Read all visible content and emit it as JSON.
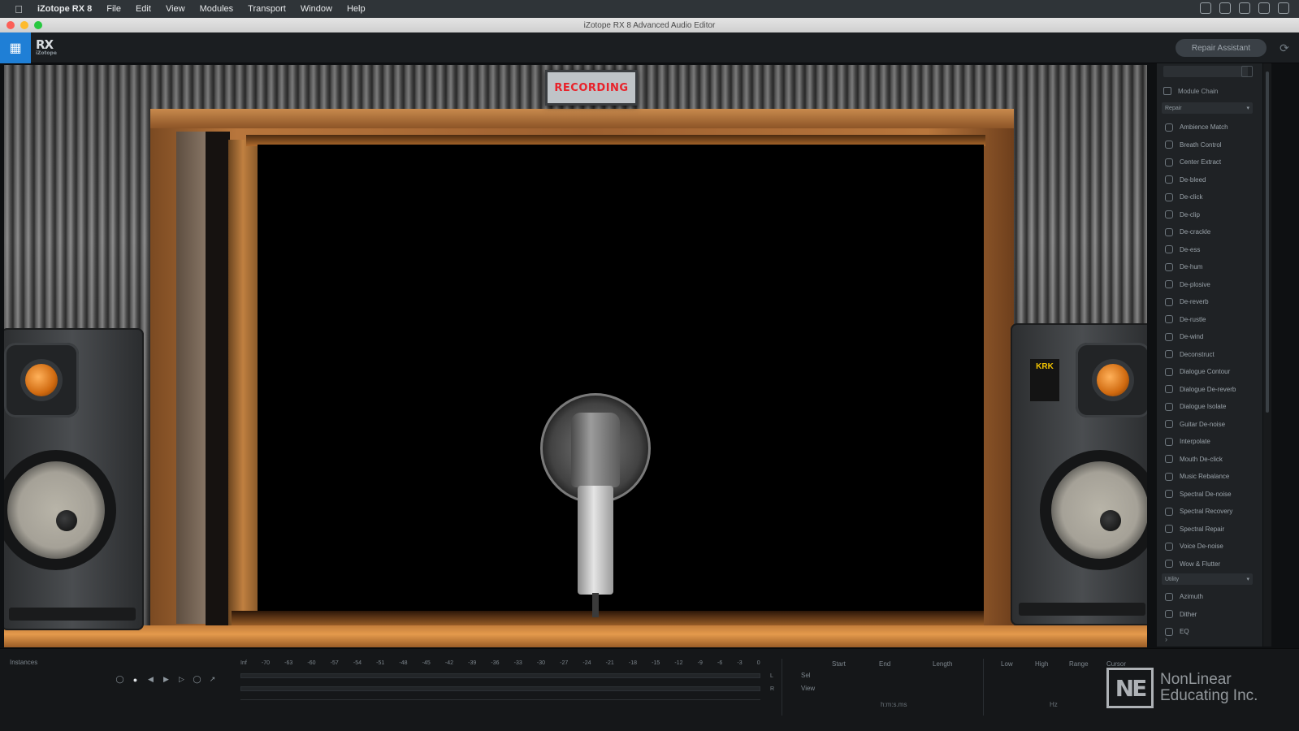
{
  "menubar": {
    "app_name": "iZotope RX 8",
    "items": [
      "File",
      "Edit",
      "View",
      "Modules",
      "Transport",
      "Window",
      "Help"
    ]
  },
  "window": {
    "title": "iZotope RX 8 Advanced Audio Editor"
  },
  "toolbar": {
    "logo": "RX",
    "logo_sub": "iZotope",
    "repair_assistant": "Repair Assistant"
  },
  "video": {
    "sign_text": "RECORDING",
    "speaker_brand": "KRK"
  },
  "sidebar": {
    "module_chain": "Module Chain",
    "repair_group": "Repair",
    "modules": [
      "Ambience Match",
      "Breath Control",
      "Center Extract",
      "De-bleed",
      "De-click",
      "De-clip",
      "De-crackle",
      "De-ess",
      "De-hum",
      "De-plosive",
      "De-reverb",
      "De-rustle",
      "De-wind",
      "Deconstruct",
      "Dialogue Contour",
      "Dialogue De-reverb",
      "Dialogue Isolate",
      "Guitar De-noise",
      "Interpolate",
      "Mouth De-click",
      "Music Rebalance",
      "Spectral De-noise",
      "Spectral Recovery",
      "Spectral Repair",
      "Voice De-noise",
      "Wow & Flutter"
    ],
    "utility_group": "Utility",
    "utilities": [
      "Azimuth",
      "Dither",
      "EQ"
    ]
  },
  "bottom": {
    "section_label": "Instances",
    "meter_labels": [
      "Inf",
      "-70",
      "-63",
      "-60",
      "-57",
      "-54",
      "-51",
      "-48",
      "-45",
      "-42",
      "-39",
      "-36",
      "-33",
      "-30",
      "-27",
      "-24",
      "-21",
      "-18",
      "-15",
      "-12",
      "-9",
      "-6",
      "-3",
      "0"
    ],
    "channels": [
      "L",
      "R"
    ],
    "sel_label": "Sel",
    "view_label": "View",
    "columns": [
      "Start",
      "End",
      "Length",
      "Low",
      "High",
      "Range",
      "Cursor"
    ],
    "time_format": "h:m:s.ms",
    "freq_unit": "Hz"
  },
  "watermark": {
    "logo": "NE",
    "line1": "NonLinear",
    "line2": "Educating Inc."
  }
}
